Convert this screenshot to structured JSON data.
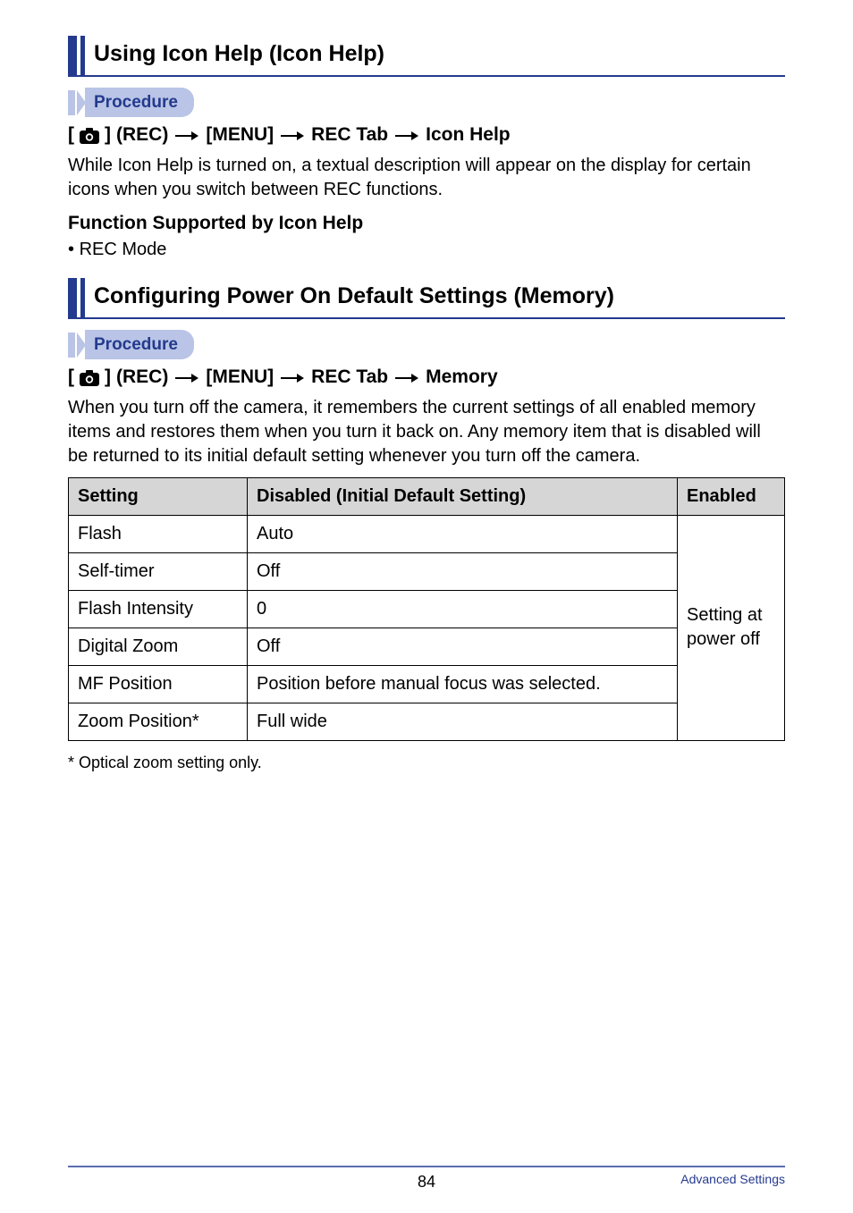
{
  "section1": {
    "title": "Using Icon Help (Icon Help)",
    "procedure_label": "Procedure",
    "path": {
      "bracket_open": "[",
      "bracket_close": "]",
      "rec": " (REC) ",
      "menu": " [MENU] ",
      "tab": " REC Tab ",
      "target": " Icon Help"
    },
    "body": "While Icon Help is turned on, a textual description will appear on the display for certain icons when you switch between REC functions.",
    "subhead": "Function Supported by Icon Help",
    "bullet": "REC Mode"
  },
  "section2": {
    "title": "Configuring Power On Default Settings (Memory)",
    "procedure_label": "Procedure",
    "path": {
      "bracket_open": "[",
      "bracket_close": "]",
      "rec": " (REC) ",
      "menu": " [MENU] ",
      "tab": " REC Tab ",
      "target": " Memory"
    },
    "body": "When you turn off the camera, it remembers the current settings of all enabled memory items and restores them when you turn it back on. Any memory item that is disabled will be returned to its initial default setting whenever you turn off the camera."
  },
  "table": {
    "headers": {
      "setting": "Setting",
      "disabled": "Disabled (Initial Default Setting)",
      "enabled": "Enabled"
    },
    "rows": [
      {
        "setting": "Flash",
        "disabled": "Auto"
      },
      {
        "setting": "Self-timer",
        "disabled": "Off"
      },
      {
        "setting": "Flash Intensity",
        "disabled": "0"
      },
      {
        "setting": "Digital Zoom",
        "disabled": "Off"
      },
      {
        "setting": "MF Position",
        "disabled": "Position before manual focus was selected."
      },
      {
        "setting": "Zoom Position*",
        "disabled": "Full wide"
      }
    ],
    "enabled_text": "Setting at power off"
  },
  "footnote": "Optical zoom setting only.",
  "footnote_marker": "*",
  "footer": {
    "page": "84",
    "right": "Advanced Settings"
  }
}
